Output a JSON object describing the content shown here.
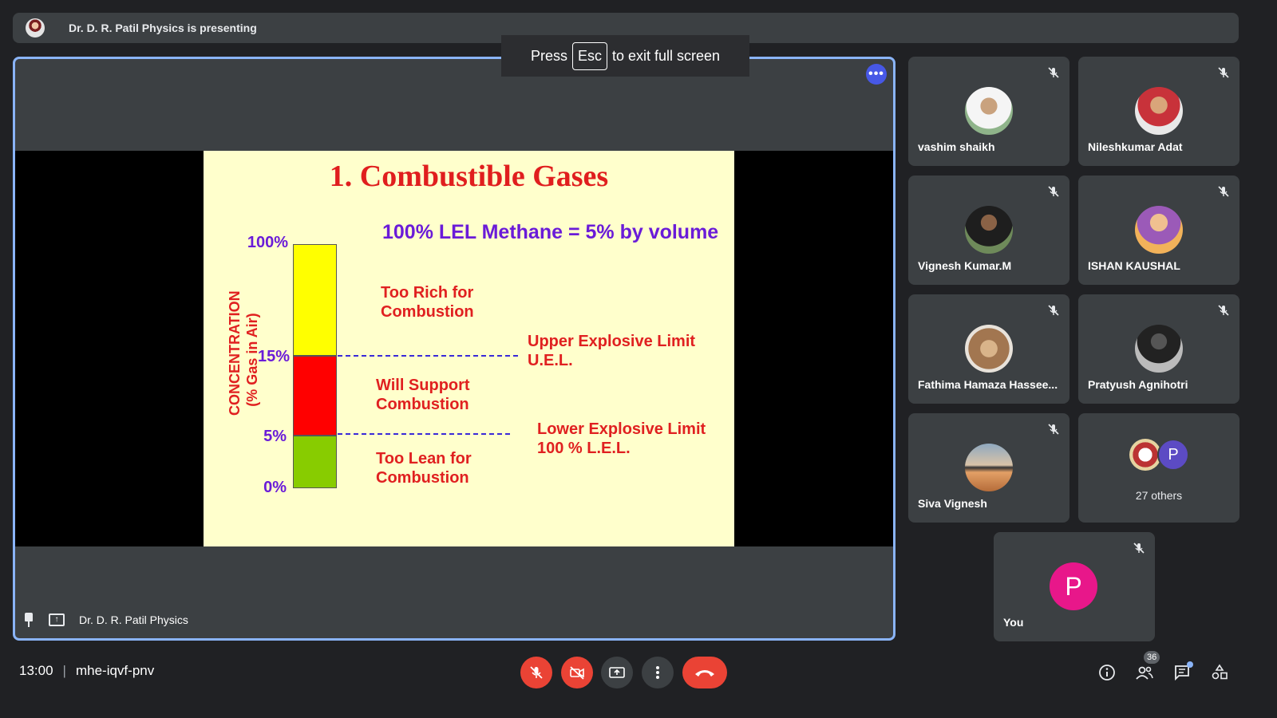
{
  "presenting_banner": {
    "text": "Dr. D. R. Patil Physics is presenting"
  },
  "esc_toast": {
    "before": "Press",
    "key": "Esc",
    "after": "to exit full screen"
  },
  "stage": {
    "presenter_name": "Dr. D. R. Patil Physics",
    "more_label": "•••"
  },
  "slide": {
    "title": "1. Combustible Gases",
    "lel_note": "100% LEL Methane = 5% by volume",
    "axis_line1": "CONCENTRATION",
    "axis_line2": "(% Gas in Air)",
    "pct_100": "100%",
    "pct_15": "15%",
    "pct_5": "5%",
    "pct_0": "0%",
    "rich_line1": "Too Rich for",
    "rich_line2": "Combustion",
    "support_line1": "Will Support",
    "support_line2": "Combustion",
    "lean_line1": "Too Lean for",
    "lean_line2": "Combustion",
    "uel_line1": "Upper Explosive Limit",
    "uel_line2": "U.E.L.",
    "lel_line1": "Lower Explosive Limit",
    "lel_line2": "100 % L.E.L."
  },
  "participants": [
    {
      "name": "vashim shaikh"
    },
    {
      "name": "Nileshkumar Adat"
    },
    {
      "name": "Vignesh Kumar.M"
    },
    {
      "name": "ISHAN KAUSHAL"
    },
    {
      "name": "Fathima Hamaza Hassee..."
    },
    {
      "name": "Pratyush Agnihotri"
    },
    {
      "name": "Siva Vignesh"
    }
  ],
  "others": {
    "label": "27 others",
    "avatar_letter": "P"
  },
  "you": {
    "name": "You",
    "avatar_letter": "P"
  },
  "meeting": {
    "time": "13:00",
    "separator": "|",
    "code": "mhe-iqvf-pnv"
  },
  "people_count": "36",
  "colors": {
    "accent": "#8ab4f8",
    "danger": "#ea4335",
    "tile": "#3c4043",
    "background": "#202124",
    "you_avatar": "#e8178a"
  }
}
